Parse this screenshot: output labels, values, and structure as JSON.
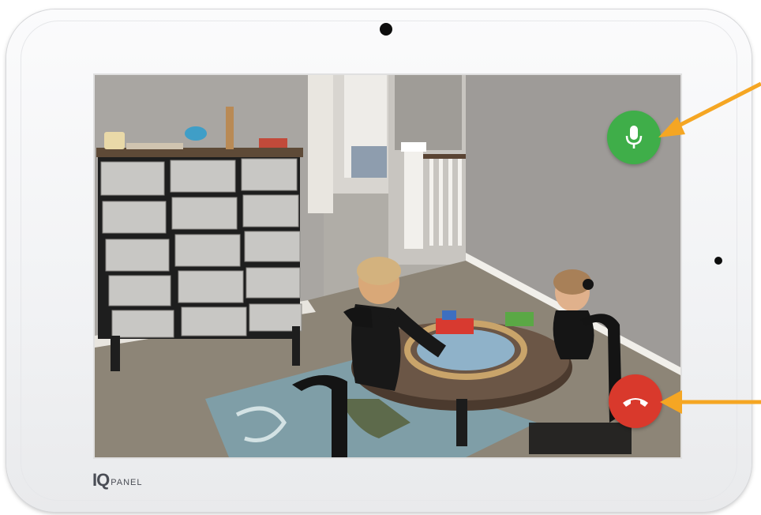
{
  "device": {
    "brand": {
      "iq": "IQ",
      "panel": "PANEL"
    }
  },
  "call": {
    "microphone_button": {
      "icon": "microphone-icon",
      "color": "#3fae49"
    },
    "end_call_button": {
      "icon": "phone-hangup-icon",
      "color": "#d9392c"
    }
  },
  "annotations": {
    "arrow_color": "#f5a623"
  },
  "video_feed": {
    "scene": "camera-video"
  }
}
